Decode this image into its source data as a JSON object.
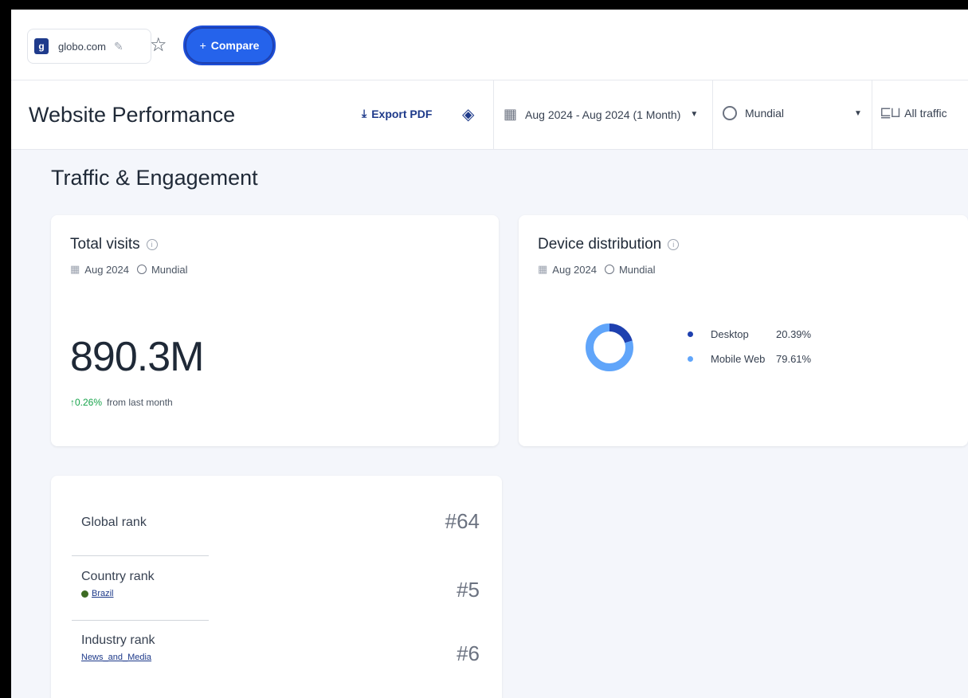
{
  "topbar": {
    "domain": "globo.com",
    "favicon_letter": "g",
    "compare_label": "Compare"
  },
  "header": {
    "title": "Website Performance",
    "export_label": "Export PDF",
    "date_range": "Aug 2024 - Aug 2024 (1 Month)",
    "region": "Mundial",
    "traffic_type": "All traffic"
  },
  "section": {
    "title": "Traffic & Engagement"
  },
  "total_visits": {
    "title": "Total visits",
    "period": "Aug 2024",
    "region": "Mundial",
    "value": "890.3M",
    "delta": "0.26%",
    "delta_suffix": "from last month"
  },
  "device_distribution": {
    "title": "Device distribution",
    "period": "Aug 2024",
    "region": "Mundial",
    "segments": [
      {
        "label": "Desktop",
        "value": "20.39%",
        "share": 20.39,
        "color": "#1e40af"
      },
      {
        "label": "Mobile Web",
        "value": "79.61%",
        "share": 79.61,
        "color": "#60a5fa"
      }
    ]
  },
  "ranks": [
    {
      "label": "Global rank",
      "value": "#64",
      "sub": ""
    },
    {
      "label": "Country rank",
      "value": "#5",
      "sub": "Brazil"
    },
    {
      "label": "Industry rank",
      "value": "#6",
      "sub": "News_and_Media"
    }
  ],
  "colors": {
    "accent": "#2563eb",
    "positive": "#16a34a",
    "link": "#1e3a8a"
  }
}
